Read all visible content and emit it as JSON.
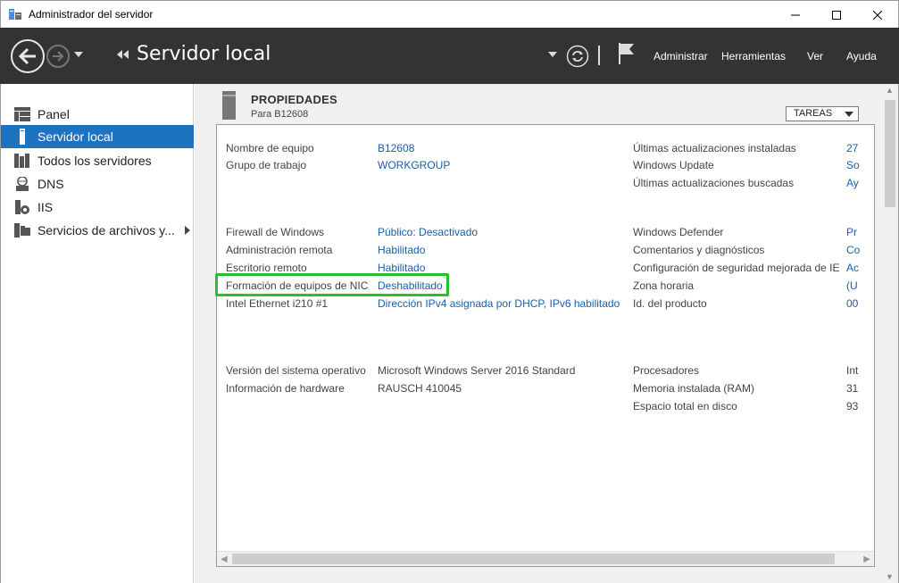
{
  "window": {
    "title": "Administrador del servidor"
  },
  "header": {
    "page_title": "Servidor local",
    "menu": [
      "Administrar",
      "Herramientas",
      "Ver",
      "Ayuda"
    ]
  },
  "sidebar": {
    "items": [
      {
        "label": "Panel",
        "icon": "dashboard-icon"
      },
      {
        "label": "Servidor local",
        "icon": "server-icon",
        "active": true
      },
      {
        "label": "Todos los servidores",
        "icon": "servers-icon"
      },
      {
        "label": "DNS",
        "icon": "dns-icon"
      },
      {
        "label": "IIS",
        "icon": "iis-icon"
      },
      {
        "label": "Servicios de archivos y...",
        "icon": "file-services-icon"
      }
    ]
  },
  "properties": {
    "title": "PROPIEDADES",
    "subtitle": "Para B12608",
    "tasks_label": "TAREAS",
    "left": [
      {
        "label": "Nombre de equipo",
        "value": "B12608",
        "link": true
      },
      {
        "label": "Grupo de trabajo",
        "value": "WORKGROUP",
        "link": true
      },
      {
        "label": "Firewall de Windows",
        "value": "Público: Desactivado",
        "link": true
      },
      {
        "label": "Administración remota",
        "value": "Habilitado",
        "link": true
      },
      {
        "label": "Escritorio remoto",
        "value": "Habilitado",
        "link": true
      },
      {
        "label": "Formación de equipos de NIC",
        "value": "Deshabilitado",
        "link": true
      },
      {
        "label": "Intel Ethernet i210 #1",
        "value": "Dirección IPv4 asignada por DHCP, IPv6 habilitado",
        "link": true
      },
      {
        "label": "Versión del sistema operativo",
        "value": "Microsoft Windows Server 2016 Standard",
        "link": false
      },
      {
        "label": "Información de hardware",
        "value": "RAUSCH 410045",
        "link": false
      }
    ],
    "right": [
      {
        "label": "Últimas actualizaciones instaladas",
        "value": "27",
        "link": true
      },
      {
        "label": "Windows Update",
        "value": "So",
        "link": true
      },
      {
        "label": "Últimas actualizaciones buscadas",
        "value": "Ay",
        "link": true
      },
      {
        "label": "Windows Defender",
        "value": "Pr",
        "link": true
      },
      {
        "label": "Comentarios y diagnósticos",
        "value": "Co",
        "link": true
      },
      {
        "label": "Configuración de seguridad mejorada de IE",
        "value": "Ac",
        "link": true
      },
      {
        "label": "Zona horaria",
        "value": "(U",
        "link": true
      },
      {
        "label": "Id. del producto",
        "value": "00",
        "link": true
      },
      {
        "label": "Procesadores",
        "value": "Int",
        "link": false
      },
      {
        "label": "Memoria instalada (RAM)",
        "value": "31",
        "link": false
      },
      {
        "label": "Espacio total en disco",
        "value": "93",
        "link": false
      }
    ]
  },
  "colors": {
    "accent": "#1e73c0",
    "link": "#1a5fa8",
    "highlight": "#2bbf2b",
    "header_bg": "#333333"
  }
}
